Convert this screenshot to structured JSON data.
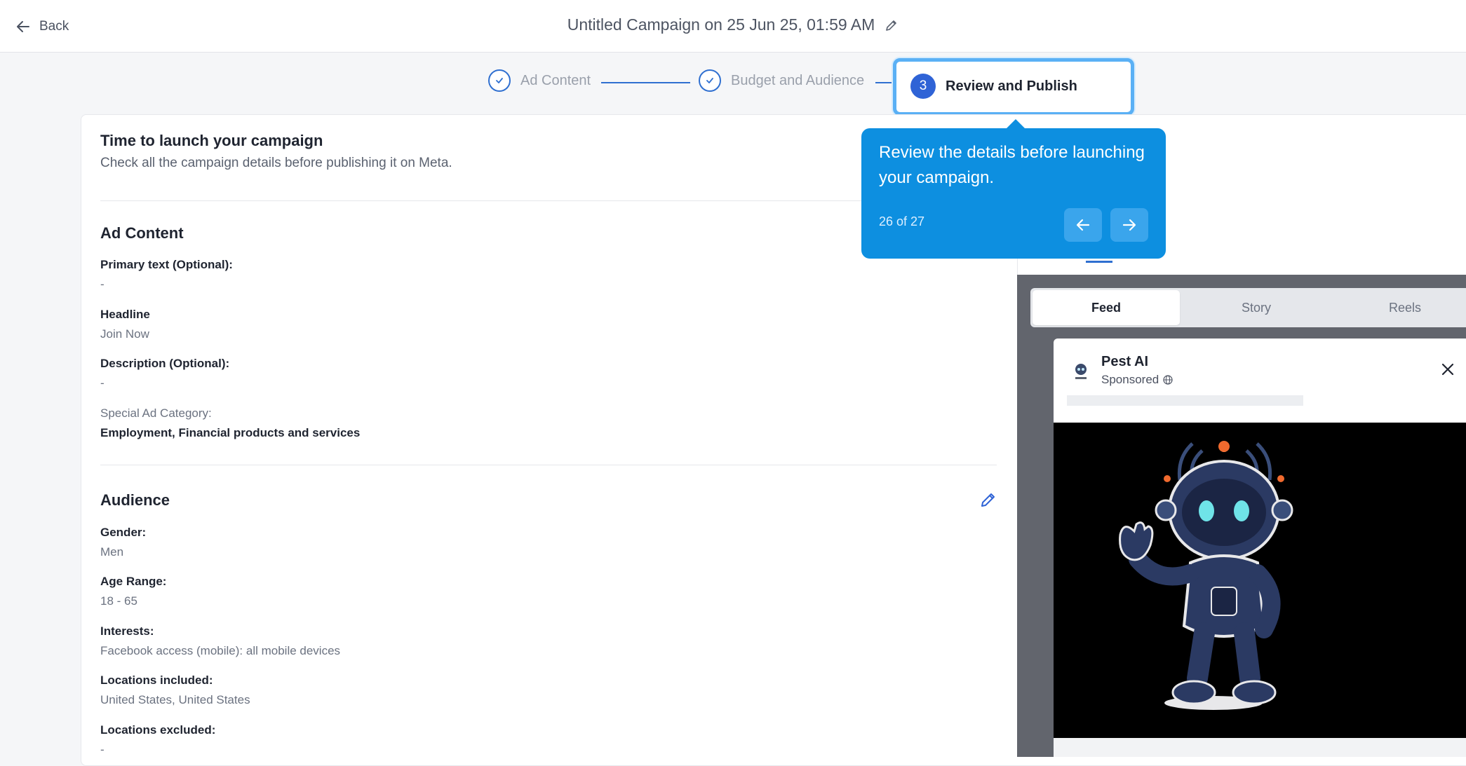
{
  "header": {
    "back_label": "Back",
    "campaign_title": "Untitled Campaign on 25 Jun 25, 01:59 AM"
  },
  "stepper": {
    "steps": [
      {
        "label": "Ad Content",
        "state": "done"
      },
      {
        "label": "Budget and Audience",
        "state": "done"
      },
      {
        "label": "Review and Publish",
        "state": "active",
        "number": "3"
      }
    ]
  },
  "review": {
    "heading": "Time to launch your campaign",
    "subheading": "Check all the campaign details before publishing it on Meta."
  },
  "ad_content": {
    "title": "Ad Content",
    "fields": [
      {
        "label": "Primary text (Optional):",
        "value": "-"
      },
      {
        "label": "Headline",
        "value": "Join Now"
      },
      {
        "label": "Description (Optional):",
        "value": "-"
      },
      {
        "label": "Special Ad Category:",
        "value": "Employment, Financial products and services"
      }
    ]
  },
  "audience": {
    "title": "Audience",
    "fields": [
      {
        "label": "Gender:",
        "value": "Men"
      },
      {
        "label": "Age Range:",
        "value": "18 - 65"
      },
      {
        "label": "Interests:",
        "value": "Facebook access (mobile): all mobile devices"
      },
      {
        "label": "Locations included:",
        "value": "United States, United States"
      },
      {
        "label": "Locations excluded:",
        "value": "-"
      }
    ]
  },
  "preview": {
    "tabs": [
      "Feed",
      "Story",
      "Reels"
    ],
    "active_tab": "Feed",
    "page_name": "Pest AI",
    "sponsored_label": "Sponsored"
  },
  "tour": {
    "text": "Review the details before launching your campaign.",
    "counter": "26 of 27"
  },
  "colors": {
    "accent": "#2f6fd0",
    "tooltip_bg": "#0d8fe0"
  }
}
